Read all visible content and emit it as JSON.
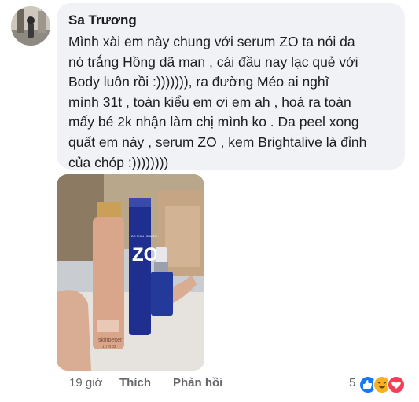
{
  "comment": {
    "author": "Sa Trương",
    "lines": [
      "Mình xài em này chung với serum ZO ta nói da",
      "nó trắng Hồng dã man , cái đầu nay lạc quẻ với",
      "Body luôn rồi :))))))), ra đường Méo ai nghĩ",
      "mình 31t , toàn kiểu em ơi em ah , hoá ra toàn",
      "mấy bé 2k nhận làm chị mình ko . Da peel xong",
      "quất em này , serum ZO , kem Brightalive là đỉnh",
      "của chóp :))))))))"
    ]
  },
  "photo": {
    "bottle_left_brand": "skinbetter",
    "bottle_left_size": "1.7 fl oz",
    "bottle_mid_brand": "ZO",
    "bottle_mid_text": "ZO SKIN HEALTH",
    "colors": {
      "pink": "#d9a68c",
      "navy": "#1f2f8f",
      "gold": "#c89a4b"
    }
  },
  "actions": {
    "time": "19 giờ",
    "like_label": "Thích",
    "reply_label": "Phản hồi",
    "reaction_count": "5",
    "reaction_icons": [
      "like-icon",
      "haha-icon",
      "love-icon"
    ]
  }
}
